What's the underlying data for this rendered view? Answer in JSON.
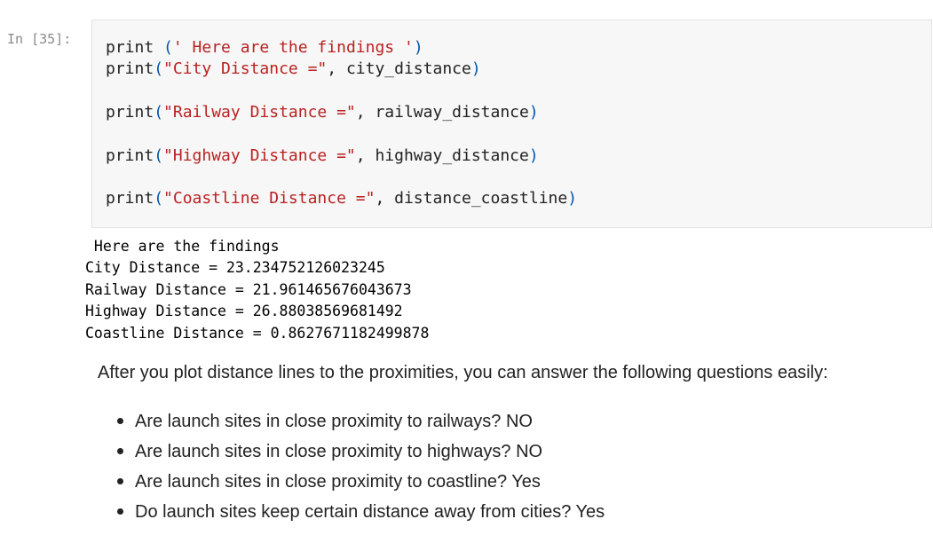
{
  "cell": {
    "prompt": "In [35]:",
    "code": [
      {
        "fn": "print",
        "open": " (",
        "str": "' Here are the findings '",
        "sep": "",
        "arg": "",
        "close": ")"
      },
      {
        "fn": "print",
        "open": "(",
        "str": "\"City Distance =\"",
        "sep": ",",
        "arg": " city_distance",
        "close": ")"
      },
      {
        "fn": "print",
        "open": "(",
        "str": "\"Railway Distance =\"",
        "sep": ",",
        "arg": " railway_distance",
        "close": ")"
      },
      {
        "fn": "print",
        "open": "(",
        "str": "\"Highway Distance =\"",
        "sep": ",",
        "arg": " highway_distance",
        "close": ")"
      },
      {
        "fn": "print",
        "open": "(",
        "str": "\"Coastline Distance =\"",
        "sep": ",",
        "arg": " distance_coastline",
        "close": ")"
      }
    ]
  },
  "output": {
    "lines": [
      " Here are the findings",
      "City Distance = 23.234752126023245",
      "Railway Distance = 21.961465676043673",
      "Highway Distance = 26.88038569681492",
      "Coastline Distance = 0.8627671182499878"
    ]
  },
  "markdown": {
    "intro": "After you plot distance lines to the proximities, you can answer the following questions easily:",
    "questions": [
      "Are launch sites in close proximity to railways? NO",
      "Are launch sites in close proximity to highways? NO",
      "Are launch sites in close proximity to coastline? Yes",
      "Do launch sites keep certain distance away from cities? Yes"
    ]
  }
}
